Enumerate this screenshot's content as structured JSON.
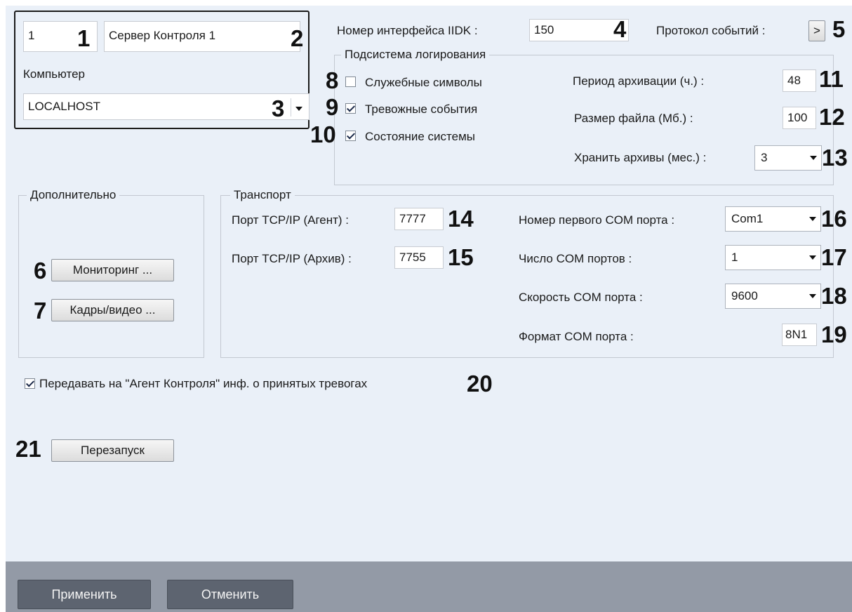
{
  "server": {
    "id_value": "1",
    "name_value": "Сервер Контроля 1",
    "computer_label": "Компьютер",
    "computer_value": "LOCALHOST"
  },
  "iidk": {
    "label": "Номер интерфейса IIDK :",
    "value": "150"
  },
  "protocol": {
    "label": "Протокол событий :",
    "button": ">"
  },
  "logging": {
    "title": "Подсистема логирования",
    "service_symbols": {
      "label": "Служебные символы",
      "checked": false
    },
    "alarm_events": {
      "label": "Тревожные события",
      "checked": true
    },
    "system_state": {
      "label": "Состояние системы",
      "checked": true
    },
    "archive_period_label": "Период архивации (ч.) :",
    "archive_period_value": "48",
    "file_size_label": "Размер файла (Мб.) :",
    "file_size_value": "100",
    "keep_archives_label": "Хранить архивы (мес.) :",
    "keep_archives_value": "3"
  },
  "additional": {
    "title": "Дополнительно",
    "monitoring_button": "Мониторинг ...",
    "frames_button": "Кадры/видео ..."
  },
  "transport": {
    "title": "Транспорт",
    "tcp_agent_label": "Порт TCP/IP (Агент) :",
    "tcp_agent_value": "7777",
    "tcp_archive_label": "Порт TCP/IP (Архив) :",
    "tcp_archive_value": "7755",
    "first_com_label": "Номер первого COM порта :",
    "first_com_value": "Com1",
    "com_count_label": "Число COM портов :",
    "com_count_value": "1",
    "com_speed_label": "Скорость COM порта :",
    "com_speed_value": "9600",
    "com_format_label": "Формат COM порта :",
    "com_format_value": "8N1"
  },
  "send_alarms": {
    "label": "Передавать на \"Агент Контроля\" инф. о принятых тревогах",
    "checked": true
  },
  "restart_button": "Перезапуск",
  "footer": {
    "apply": "Применить",
    "cancel": "Отменить"
  },
  "callouts": [
    "1",
    "2",
    "3",
    "4",
    "5",
    "6",
    "7",
    "8",
    "9",
    "10",
    "11",
    "12",
    "13",
    "14",
    "15",
    "16",
    "17",
    "18",
    "19",
    "20",
    "21"
  ]
}
